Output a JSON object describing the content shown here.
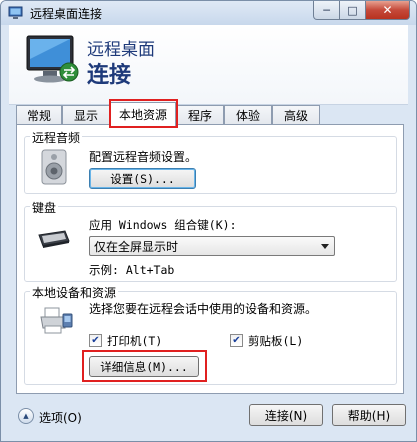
{
  "window": {
    "title": "远程桌面连接",
    "caption": {
      "minimize": "─",
      "maximize": "□",
      "close": "✕"
    }
  },
  "header": {
    "line1": "远程桌面",
    "line2": "连接"
  },
  "tabs": [
    {
      "label": "常规",
      "active": false
    },
    {
      "label": "显示",
      "active": false
    },
    {
      "label": "本地资源",
      "active": true
    },
    {
      "label": "程序",
      "active": false
    },
    {
      "label": "体验",
      "active": false
    },
    {
      "label": "高级",
      "active": false
    }
  ],
  "remote_audio": {
    "title": "远程音频",
    "description": "配置远程音频设置。",
    "settings_button": "设置(S)..."
  },
  "keyboard": {
    "title": "键盘",
    "description": "应用 Windows 组合键(K):",
    "selected_option": "仅在全屏显示时",
    "example": "示例: Alt+Tab"
  },
  "local_devices": {
    "title": "本地设备和资源",
    "description": "选择您要在远程会话中使用的设备和资源。",
    "printer_label": "打印机(T)",
    "printer_checked": true,
    "clipboard_label": "剪贴板(L)",
    "clipboard_checked": true,
    "details_button": "详细信息(M)..."
  },
  "footer": {
    "options_label": "选项(O)",
    "connect_button": "连接(N)",
    "help_button": "帮助(H)"
  },
  "colors": {
    "highlight_red": "#e02020",
    "header_text": "#1e3a7a"
  }
}
